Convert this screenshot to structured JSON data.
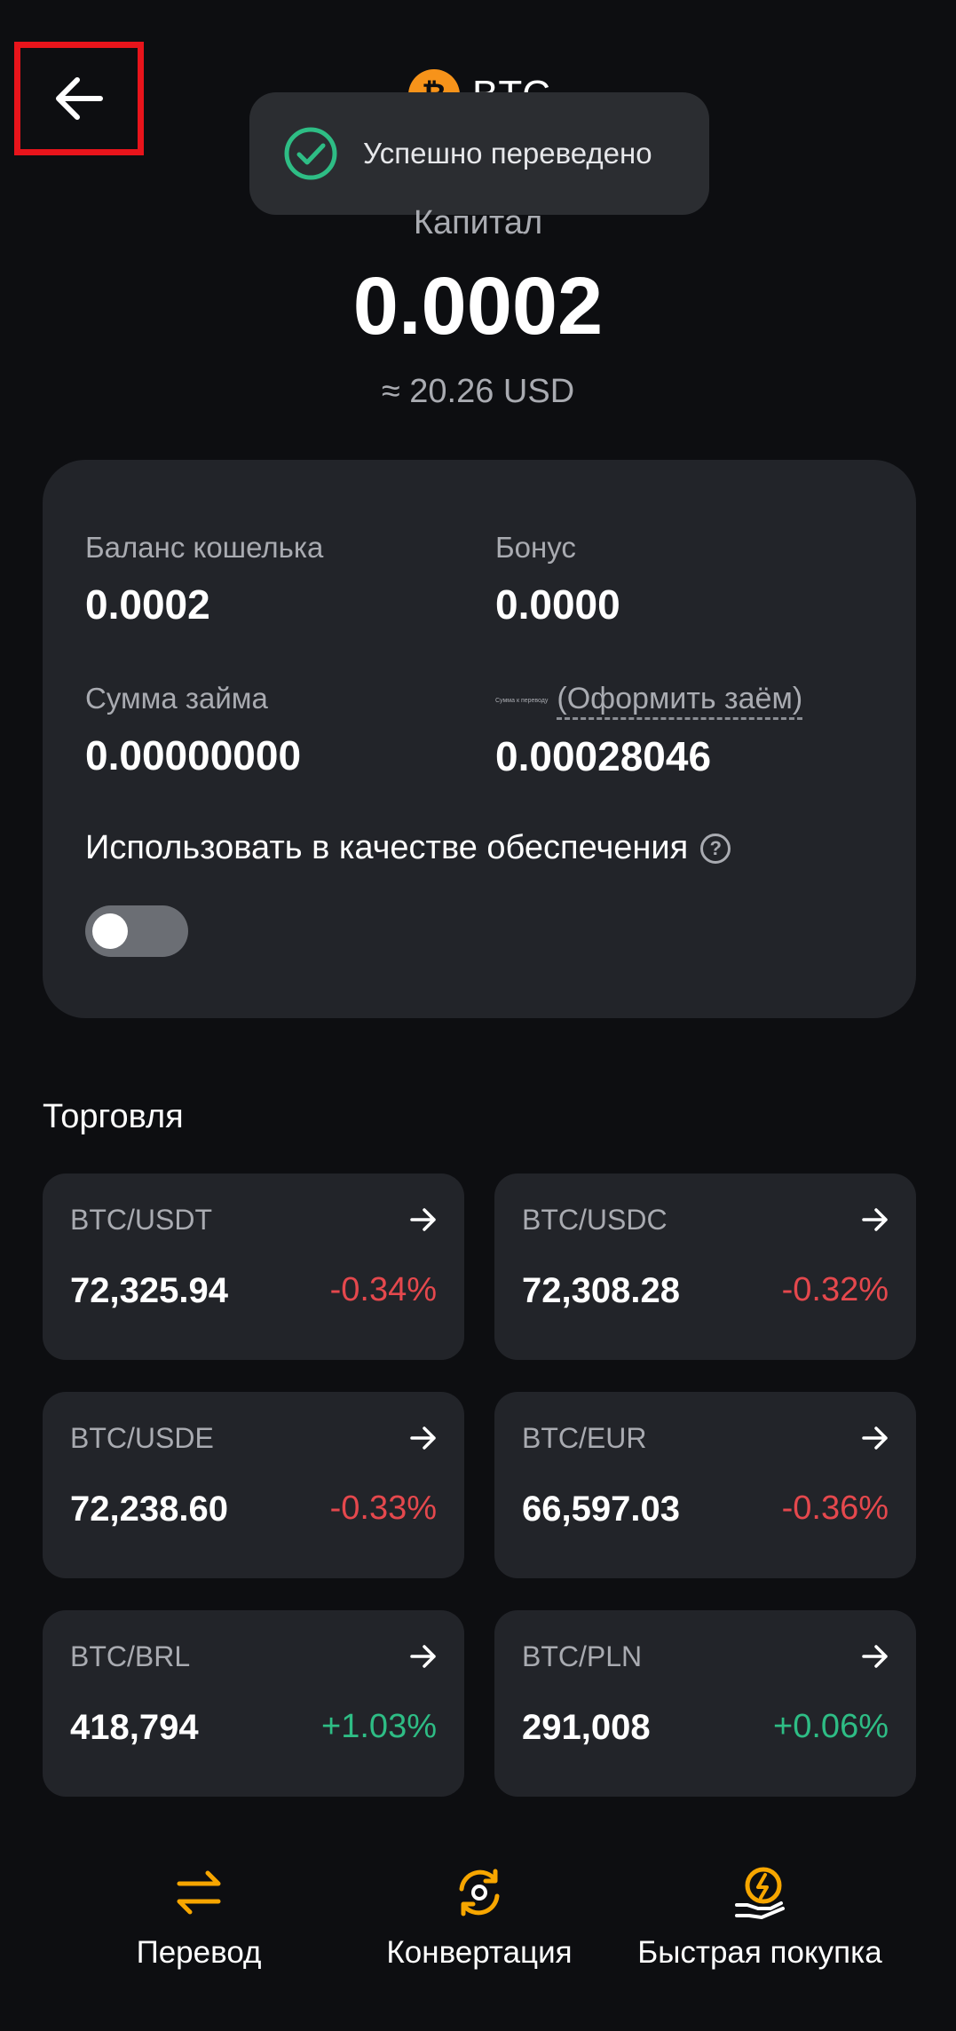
{
  "header": {
    "coin_symbol": "BTC",
    "coin_logo_glyph": "₿",
    "accent_color": "#f7931a"
  },
  "toast": {
    "message": "Успешно переведено",
    "icon": "check-circle-icon",
    "icon_color": "#2ebd85"
  },
  "equity": {
    "label": "Капитал",
    "value": "0.0002",
    "usd": "≈ 20.26 USD"
  },
  "balance_card": {
    "wallet_balance_label": "Баланс кошелька",
    "wallet_balance_value": "0.0002",
    "bonus_label": "Бонус",
    "bonus_value": "0.0000",
    "loan_label": "Сумма займа",
    "loan_value": "0.00000000",
    "transfer_amount_label": "Сумма к переводу",
    "get_loan_link": "(Оформить заём)",
    "transfer_amount_value": "0.00028046",
    "collateral_label": "Использовать в качестве обеспечения",
    "collateral_enabled": false
  },
  "trading": {
    "title": "Торговля",
    "pairs": [
      {
        "name": "BTC/USDT",
        "price": "72,325.94",
        "change": "-0.34%",
        "direction": "down"
      },
      {
        "name": "BTC/USDC",
        "price": "72,308.28",
        "change": "-0.32%",
        "direction": "down"
      },
      {
        "name": "BTC/USDE",
        "price": "72,238.60",
        "change": "-0.33%",
        "direction": "down"
      },
      {
        "name": "BTC/EUR",
        "price": "66,597.03",
        "change": "-0.36%",
        "direction": "down"
      },
      {
        "name": "BTC/BRL",
        "price": "418,794",
        "change": "+1.03%",
        "direction": "up"
      },
      {
        "name": "BTC/PLN",
        "price": "291,008",
        "change": "+0.06%",
        "direction": "up"
      }
    ]
  },
  "actions": {
    "transfer_label": "Перевод",
    "convert_label": "Конвертация",
    "quick_buy_label": "Быстрая покупка"
  }
}
